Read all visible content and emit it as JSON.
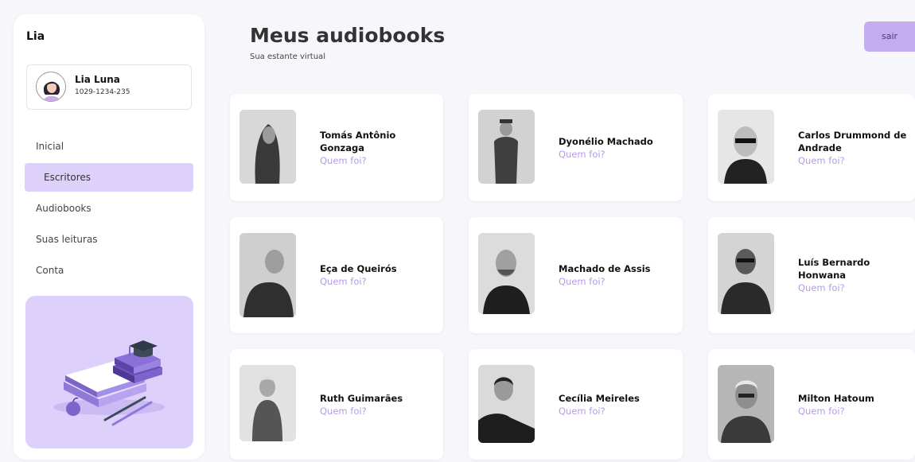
{
  "sidebar": {
    "brand": "Lia",
    "profile": {
      "name": "Lia Luna",
      "id": "1029-1234-235"
    },
    "nav": [
      {
        "label": "Inicial",
        "active": false
      },
      {
        "label": "Escritores",
        "active": true
      },
      {
        "label": "Audiobooks",
        "active": false
      },
      {
        "label": "Suas leituras",
        "active": false
      },
      {
        "label": "Conta",
        "active": false
      }
    ],
    "promo_icon": "books-graduation-cap-illustration"
  },
  "header": {
    "title": "Meus audiobooks",
    "subtitle": "Sua estante virtual",
    "logout_label": "sair"
  },
  "colors": {
    "accent": "#ddd1fb",
    "button": "#c3acef",
    "link": "#b59be8"
  },
  "authors": [
    {
      "name": "Tomás Antônio Gonzaga",
      "link": "Quem foi?"
    },
    {
      "name": "Dyonélio Machado",
      "link": "Quem foi?"
    },
    {
      "name": "Carlos Drummond de Andrade",
      "link": "Quem foi?"
    },
    {
      "name": "Eça de Queirós",
      "link": "Quem foi?"
    },
    {
      "name": "Machado de Assis",
      "link": "Quem foi?"
    },
    {
      "name": "Luís Bernardo Honwana",
      "link": "Quem foi?"
    },
    {
      "name": "Ruth Guimarães",
      "link": "Quem foi?"
    },
    {
      "name": "Cecília Meireles",
      "link": "Quem foi?"
    },
    {
      "name": "Milton Hatoum",
      "link": "Quem foi?"
    }
  ]
}
